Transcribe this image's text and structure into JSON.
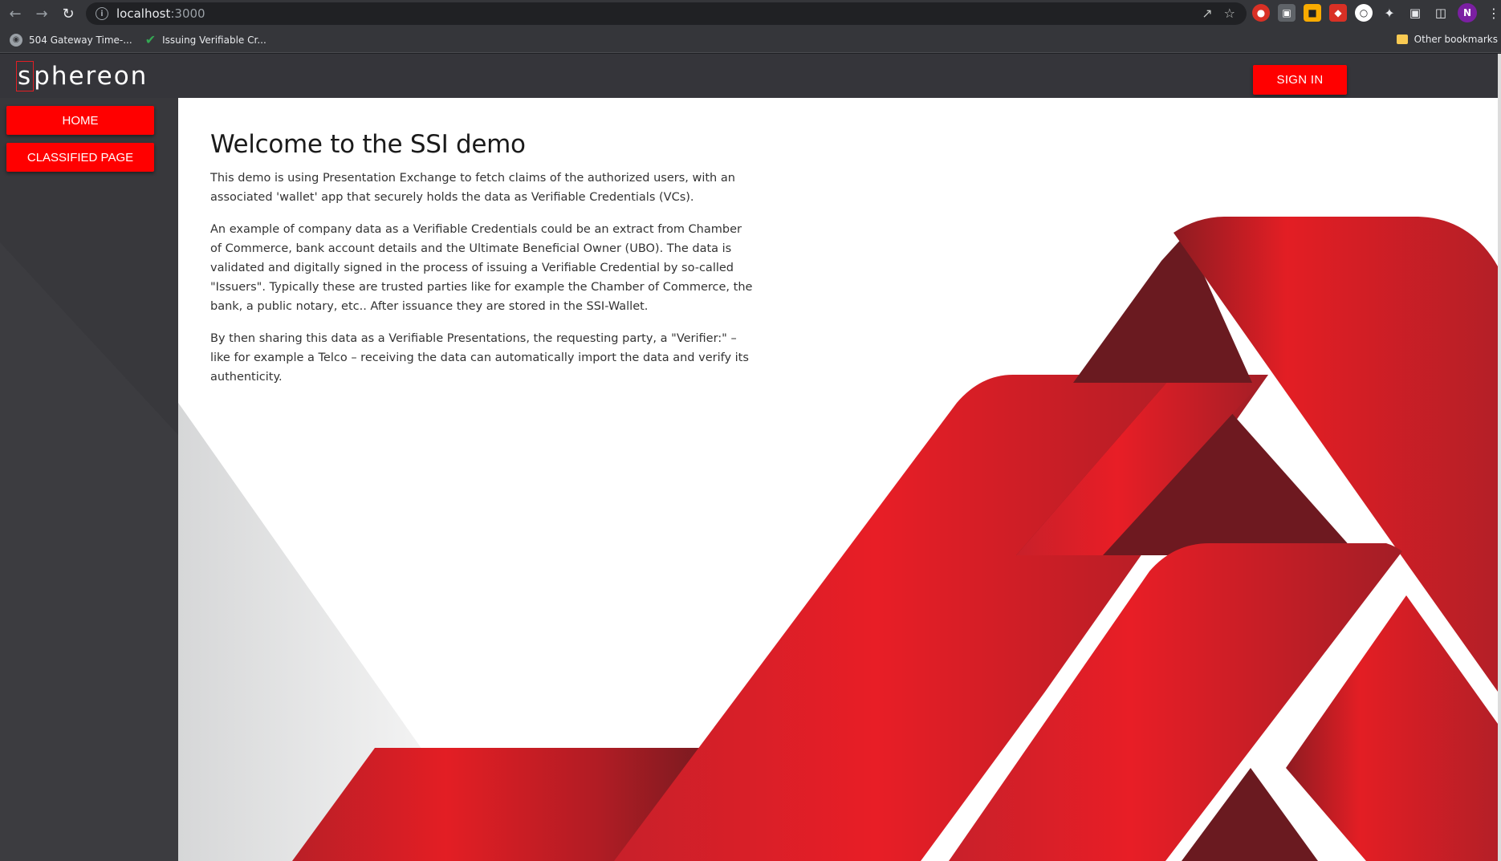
{
  "browser": {
    "url_host": "localhost",
    "url_port": ":3000",
    "bookmarks": [
      {
        "label": "504 Gateway Time-..."
      },
      {
        "label": "Issuing Verifiable Cr..."
      }
    ],
    "other_bookmarks": "Other bookmarks",
    "profile_initial": "N"
  },
  "app": {
    "logo_first": "s",
    "logo_rest": "phereon",
    "sign_in": "SIGN IN",
    "sidebar": {
      "items": [
        {
          "label": "HOME"
        },
        {
          "label": "CLASSIFIED PAGE"
        }
      ]
    },
    "main": {
      "title": "Welcome to the SSI demo",
      "paragraphs": [
        "This demo is using Presentation Exchange to fetch claims of the authorized users, with an associated 'wallet' app that securely holds the data as Verifiable Credentials (VCs).",
        "An example of company data as a Verifiable Credentials could be an extract from Chamber of Commerce, bank account details and the Ultimate Beneficial Owner (UBO). The data is validated and digitally signed in the process of issuing a Verifiable Credential by so-called \"Issuers\". Typically these are trusted parties like for example the Chamber of Commerce, the bank, a public notary, etc.. After issuance they are stored in the SSI-Wallet.",
        "By then sharing this data as a Verifiable Presentations, the requesting party, a \"Verifier:\" – like for example a Telco – receiving the data can automatically import the data and verify its authenticity."
      ]
    }
  },
  "colors": {
    "accent": "#ff0000",
    "brand_red": "#e31e24",
    "dark_red": "#6b1a1f",
    "header_bg": "#35353a"
  }
}
